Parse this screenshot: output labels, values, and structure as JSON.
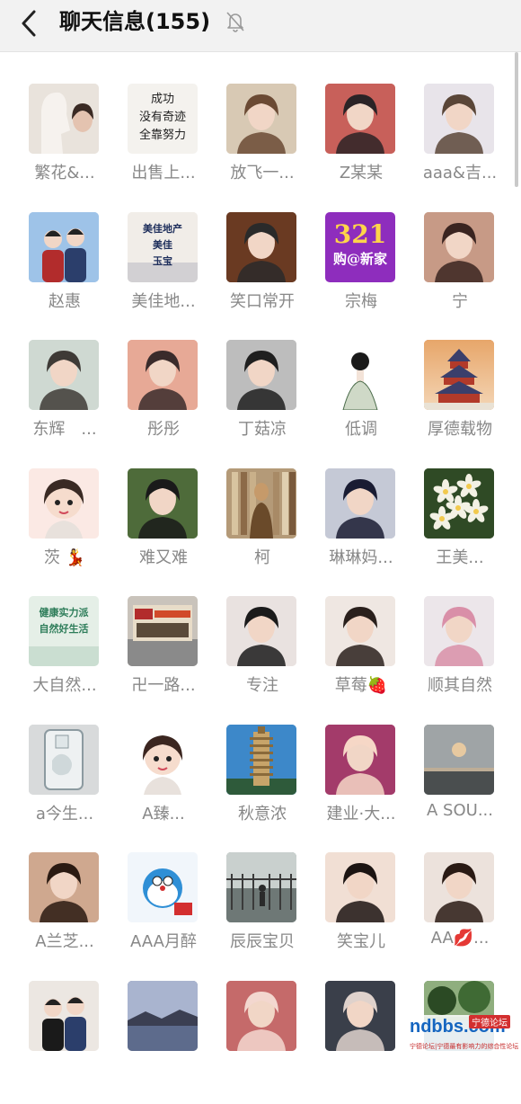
{
  "header": {
    "title": "聊天信息(155)",
    "back_icon": "chevron-left-icon",
    "mute_icon": "bell-off-icon"
  },
  "members": [
    {
      "name": "繁花&...",
      "bg": "#e9e3dc",
      "fg": "#8a7d72",
      "kind": "statue"
    },
    {
      "name": "出售上...",
      "bg": "#f4f2ee",
      "fg": "#222222",
      "kind": "text",
      "lines": [
        "成功",
        "没有奇迹",
        "全靠努力"
      ]
    },
    {
      "name": "放飞一...",
      "bg": "#d8c9b4",
      "fg": "#6b4a34",
      "kind": "person"
    },
    {
      "name": "Z某某",
      "bg": "#c8605a",
      "fg": "#2b2326",
      "kind": "person"
    },
    {
      "name": "aaa&吉...",
      "bg": "#e8e4ea",
      "fg": "#5a4638",
      "kind": "person"
    },
    {
      "name": "赵惠",
      "bg": "#9ec3e8",
      "fg": "#b22c2c",
      "kind": "couple"
    },
    {
      "name": "美佳地...",
      "bg": "#f1ede8",
      "fg": "#1f2f5c",
      "kind": "ad",
      "lines": [
        "美佳地产",
        "美佳",
        "玉宝"
      ]
    },
    {
      "name": "笑口常开",
      "bg": "#6a3a22",
      "fg": "#2a2a2a",
      "kind": "person"
    },
    {
      "name": "宗梅",
      "bg": "#8e2dbd",
      "fg": "#ffd54a",
      "kind": "promo",
      "lines": [
        "321",
        "购@新家"
      ]
    },
    {
      "name": "宁",
      "bg": "#c79a86",
      "fg": "#3a2420",
      "kind": "person"
    },
    {
      "name": "东辉　...",
      "bg": "#cfd9d2",
      "fg": "#3e3a36",
      "kind": "person"
    },
    {
      "name": "彤彤",
      "bg": "#e7a996",
      "fg": "#3a2b2b",
      "kind": "person"
    },
    {
      "name": "丁菇凉",
      "bg": "#bdbdbd",
      "fg": "#1f1f1f",
      "kind": "person"
    },
    {
      "name": "低调",
      "bg": "#ffffff",
      "fg": "#4a6b4a",
      "kind": "sketch"
    },
    {
      "name": "厚德载物",
      "bg": "#e2935a",
      "fg": "#3b3f6b",
      "kind": "temple"
    },
    {
      "name": "茨 💃",
      "bg": "#fbe9e4",
      "fg": "#3a2a24",
      "kind": "cartoon"
    },
    {
      "name": "难又难",
      "bg": "#4e6b3a",
      "fg": "#1a1a1a",
      "kind": "person"
    },
    {
      "name": "柯",
      "bg": "#c9b79a",
      "fg": "#6a4a2a",
      "kind": "books"
    },
    {
      "name": "琳琳妈...",
      "bg": "#c5c9d6",
      "fg": "#1a1c33",
      "kind": "person"
    },
    {
      "name": "王美...",
      "bg": "#2f4a25",
      "fg": "#f3f1e4",
      "kind": "flower"
    },
    {
      "name": "大自然...",
      "bg": "#e5efe7",
      "fg": "#2e7d5a",
      "kind": "ad",
      "lines": [
        "健康实力派",
        "自然好生活"
      ]
    },
    {
      "name": "卍一路...",
      "bg": "#c9c3bb",
      "fg": "#b22c2c",
      "kind": "building"
    },
    {
      "name": "专注",
      "bg": "#e9e2e0",
      "fg": "#1b1b1b",
      "kind": "person"
    },
    {
      "name": "草莓🍓",
      "bg": "#efe7e2",
      "fg": "#2a201c",
      "kind": "person"
    },
    {
      "name": "顺其自然",
      "bg": "#ece6ea",
      "fg": "#d98fa8",
      "kind": "person"
    },
    {
      "name": "a今生...",
      "bg": "#d8dadb",
      "fg": "#8c9aa0",
      "kind": "glass"
    },
    {
      "name": "A臻...",
      "bg": "#ffffff",
      "fg": "#3b2620",
      "kind": "cartoon"
    },
    {
      "name": "秋意浓",
      "bg": "#3d88c9",
      "fg": "#c7a46a",
      "kind": "tower"
    },
    {
      "name": "建业·大...",
      "bg": "#a33b6a",
      "fg": "#f6d7c6",
      "kind": "person"
    },
    {
      "name": "A SOU...",
      "bg": "#9aa0a2",
      "fg": "#e7c9a0",
      "kind": "sunset"
    },
    {
      "name": "A兰芝...",
      "bg": "#cfa88f",
      "fg": "#2a1a12",
      "kind": "person"
    },
    {
      "name": "AAA月醉",
      "bg": "#f1f6fb",
      "fg": "#2f8fd6",
      "kind": "doraemon"
    },
    {
      "name": "辰辰宝贝",
      "bg": "#9ba6a3",
      "fg": "#3a3a3a",
      "kind": "bridge"
    },
    {
      "name": "笑宝儿",
      "bg": "#f1dfd4",
      "fg": "#1c1412",
      "kind": "person"
    },
    {
      "name": "AA💋...",
      "bg": "#ece2dc",
      "fg": "#2a1a14",
      "kind": "person"
    },
    {
      "name": "",
      "bg": "#ece7e2",
      "fg": "#1a1a1a",
      "kind": "couple"
    },
    {
      "name": "",
      "bg": "#8a95b2",
      "fg": "#3b3f52",
      "kind": "sea"
    },
    {
      "name": "",
      "bg": "#c56a6a",
      "fg": "#f3d7cf",
      "kind": "person"
    },
    {
      "name": "",
      "bg": "#3a3f4a",
      "fg": "#dfd2cc",
      "kind": "person"
    },
    {
      "name": "",
      "bg": "#5f8a52",
      "fg": "#2b4a24",
      "kind": "lake"
    }
  ],
  "watermark": {
    "site": "ndbbs.com",
    "tag": "宁德论坛",
    "sub": "宁德论坛|宁德最有影响力的综合性论坛"
  }
}
